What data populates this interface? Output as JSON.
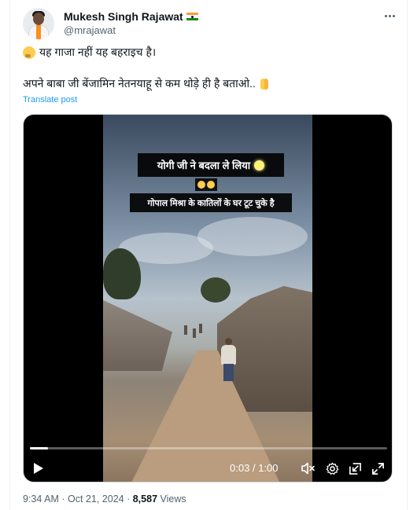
{
  "author": {
    "name": "Mukesh Singh Rajawat",
    "handle": "@mrajawat",
    "avatar_icon": "profile-photo",
    "badge_icon": "india-flag-icon"
  },
  "post": {
    "line1_emoji_icon": "thinking-face-icon",
    "line1": "यह गाजा नहीं यह बहराइच है।",
    "line2": "अपने बाबा जी बेंजामिन नेतनयाहू से कम थोड़े ही है बताओ..",
    "line2_emoji_icon": "folded-hands-icon",
    "translate": "Translate post"
  },
  "video": {
    "caption1": "योगी जी ने बदला ले लिया",
    "caption2": "गोपाल मिश्रा के कातिलों के घर टूट चुके है",
    "current_time": "0:03",
    "separator": "/",
    "duration": "1:00",
    "progress_fraction": 0.05
  },
  "meta": {
    "time": "9:34 AM",
    "dot1": "·",
    "date": "Oct 21, 2024",
    "dot2": "·",
    "views_count": "8,587",
    "views_label": "Views"
  },
  "colors": {
    "link": "#1d9bf0",
    "muted": "#536471",
    "text": "#0f1419"
  }
}
